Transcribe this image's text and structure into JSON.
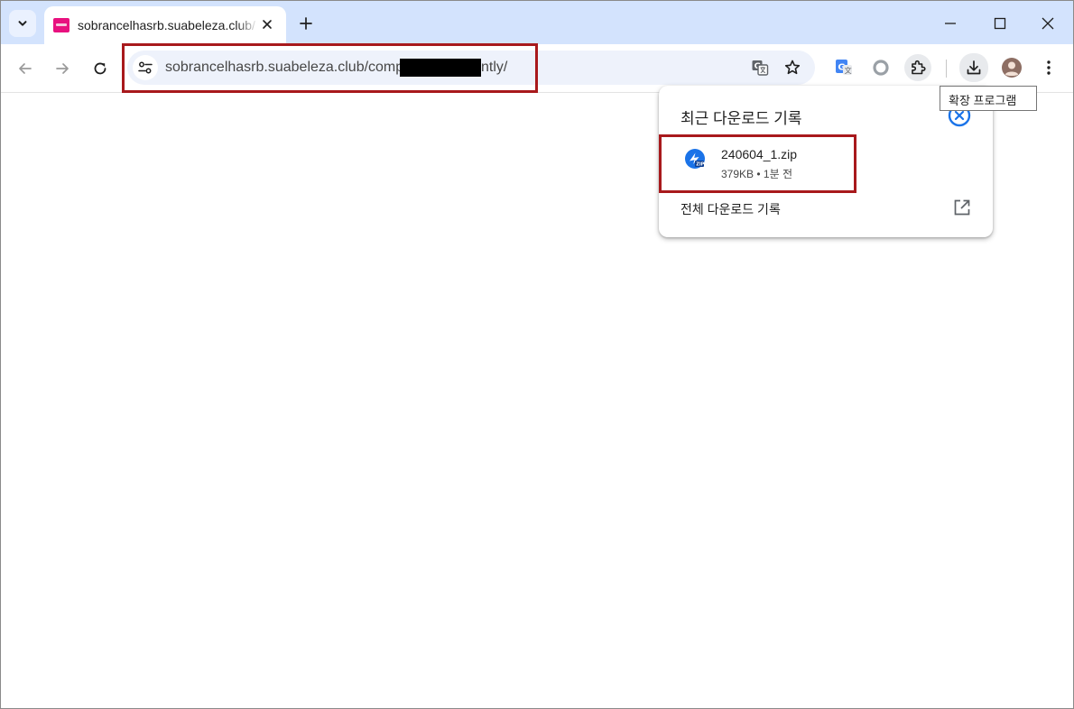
{
  "tab": {
    "title": "sobrancelhasrb.suabeleza.club/",
    "favicon": "site-favicon",
    "close_icon": "close-icon"
  },
  "window_controls": [
    "minimize-icon",
    "maximize-icon",
    "close-icon"
  ],
  "address_bar": {
    "url_visible_start": "sobrancelhasrb.suabeleza.club/comp",
    "url_visible_end": "ntly/",
    "redacted": true
  },
  "toolbar_icons": [
    "back-icon",
    "forward-icon",
    "reload-icon",
    "site-info-icon",
    "translate-icon",
    "bookmark-star-icon",
    "google-translate-extension-icon",
    "extension-circle-icon",
    "extensions-puzzle-icon",
    "download-icon",
    "profile-avatar-icon",
    "menu-dots-icon"
  ],
  "tooltip": {
    "text": "확장 프로그램"
  },
  "downloads_bubble": {
    "title": "최근 다운로드 기록",
    "items": [
      {
        "name": "240604_1.zip",
        "meta": "379KB • 1분 전",
        "icon": "zip-file-icon"
      }
    ],
    "full_history_label": "전체 다운로드 기록",
    "open_external_icon": "open-in-new-icon"
  },
  "colors": {
    "tabstrip": "#d3e3fd",
    "omnibox": "#eef2fb",
    "highlight_box": "#a8191c",
    "close_circle": "#1a73e8"
  }
}
